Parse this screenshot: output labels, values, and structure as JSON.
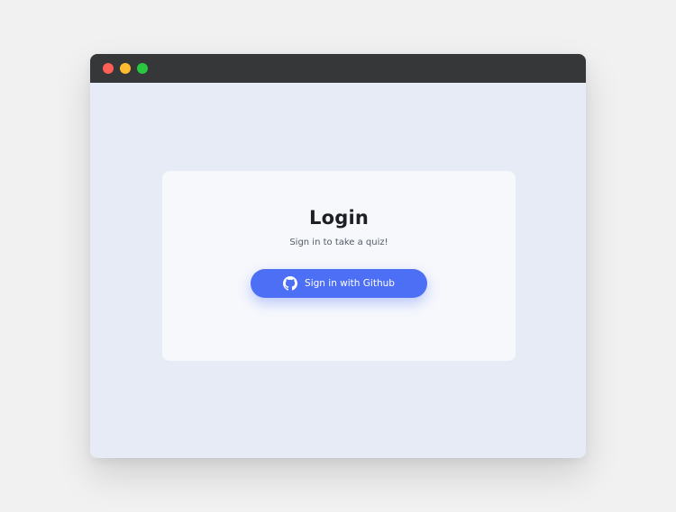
{
  "window": {
    "controls": [
      {
        "name": "close",
        "color": "#fe5f57"
      },
      {
        "name": "minimize",
        "color": "#febc2e"
      },
      {
        "name": "zoom",
        "color": "#28c840"
      }
    ]
  },
  "login": {
    "title": "Login",
    "subtitle": "Sign in to take a quiz!",
    "button_label": "Sign in with Github",
    "button_icon": "github-icon",
    "accent_color": "#4d6ff6"
  }
}
